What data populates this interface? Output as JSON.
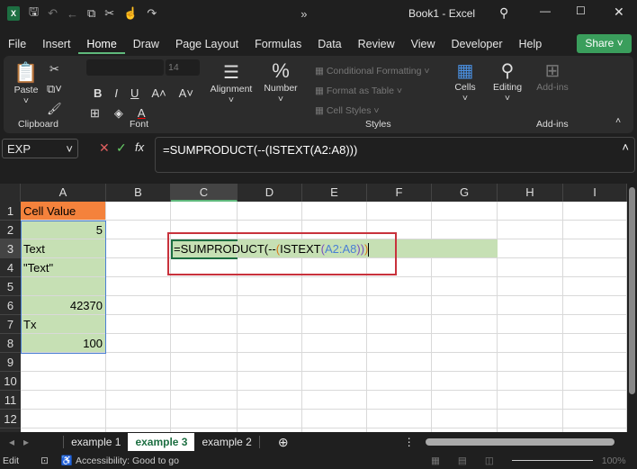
{
  "title": "Book1 - Excel",
  "menu": [
    "File",
    "Insert",
    "Home",
    "Draw",
    "Page Layout",
    "Formulas",
    "Data",
    "Review",
    "View",
    "Developer",
    "Help"
  ],
  "share": "Share",
  "ribbon": {
    "paste": "Paste",
    "clipboard": "Clipboard",
    "font_size": "14",
    "font": "Font",
    "alignment": "Alignment",
    "number": "Number",
    "number_symbol": "%",
    "cond_fmt": "Conditional Formatting",
    "fmt_table": "Format as Table",
    "cell_styles": "Cell Styles",
    "styles": "Styles",
    "cells": "Cells",
    "editing": "Editing",
    "addins": "Add-ins",
    "addins_group": "Add-ins",
    "bold": "B",
    "italic": "I",
    "underline": "U"
  },
  "namebox": "EXP",
  "formula": "=SUMPRODUCT(--(ISTEXT(A2:A8)))",
  "columns": [
    "A",
    "B",
    "C",
    "D",
    "E",
    "F",
    "G",
    "H",
    "I"
  ],
  "rows": [
    "1",
    "2",
    "3",
    "4",
    "5",
    "6",
    "7",
    "8",
    "9",
    "10",
    "11",
    "12"
  ],
  "cells": {
    "A1": "Cell Value",
    "A2": "5",
    "A3": "Text",
    "A4": "\"Text\"",
    "A5": "",
    "A6": "42370",
    "A7": "Tx",
    "A8": "100"
  },
  "edit_parts": [
    "=SUMPRODUCT(--",
    "(",
    "ISTEXT",
    "(",
    "A2:A8",
    "))",
    ")"
  ],
  "sheet_tabs": [
    "example 1",
    "example 3",
    "example 2"
  ],
  "active_sheet": "example 3",
  "status": {
    "mode": "Edit",
    "accessibility": "Accessibility: Good to go",
    "zoom": "100%"
  },
  "colors": {
    "orange": "#f4823c",
    "green": "#c6e0b4",
    "red": "#c8323c",
    "accent": "#3a9e5c"
  }
}
